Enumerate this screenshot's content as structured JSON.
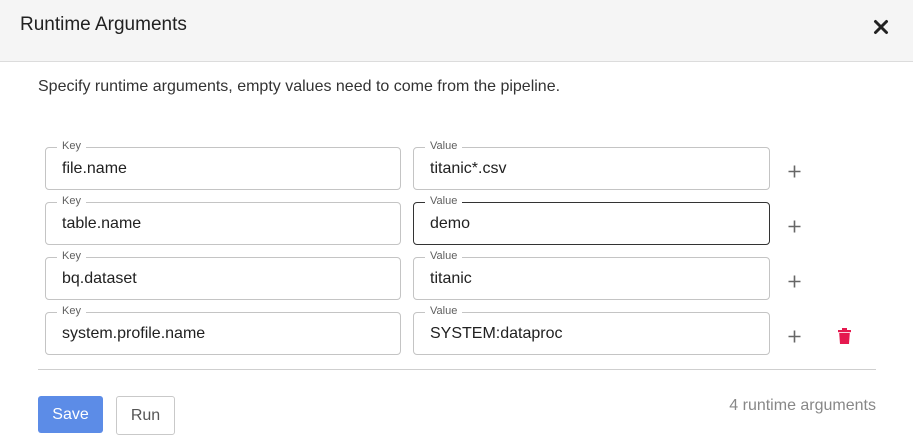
{
  "dialog": {
    "title": "Runtime Arguments",
    "close_icon": "close-icon",
    "description": "Specify runtime arguments, empty values need to come from the pipeline."
  },
  "args": [
    {
      "key_label": "Key",
      "key": "file.name",
      "value_label": "Value",
      "value": "titanic*.csv"
    },
    {
      "key_label": "Key",
      "key": "table.name",
      "value_label": "Value",
      "value": "demo"
    },
    {
      "key_label": "Key",
      "key": "bq.dataset",
      "value_label": "Value",
      "value": "titanic"
    },
    {
      "key_label": "Key",
      "key": "system.profile.name",
      "value_label": "Value",
      "value": "SYSTEM:dataproc"
    }
  ],
  "icons": {
    "add": "plus-icon",
    "delete": "trash-icon"
  },
  "colors": {
    "primary": "#5c8ce7",
    "delete": "#e5194f",
    "header_bg": "#f5f5f5"
  },
  "footer": {
    "save_label": "Save",
    "run_label": "Run",
    "count_text": "4 runtime arguments"
  }
}
